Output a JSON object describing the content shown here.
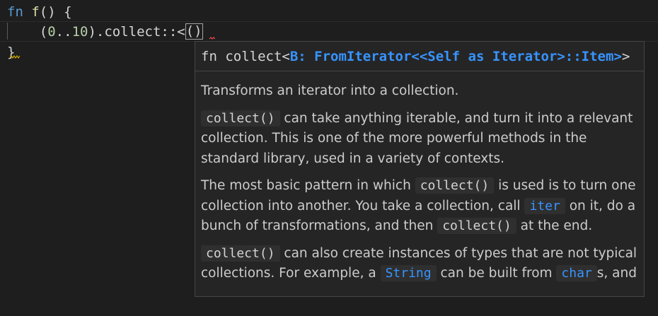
{
  "editor": {
    "line1": {
      "kw": "fn",
      "name": "f",
      "rest": "() {"
    },
    "line2": {
      "indent": "    ",
      "open": "(",
      "start": "0",
      "range": "..",
      "end": "10",
      "close": ").collect::<",
      "cursor_parens": "()"
    },
    "line3": {
      "brace": "}"
    }
  },
  "hover": {
    "signature": {
      "prefix": "fn collect<",
      "bound": "B: FromIterator<<Self as Iterator>::Item>",
      "suffix": ">"
    },
    "paragraphs": {
      "p1": "Transforms an iterator into a collection.",
      "p2_code": "collect()",
      "p2_text": " can take anything iterable, and turn it into a relevant collection. This is one of the more powerful methods in the standard library, used in a variety of contexts.",
      "p3_a": "The most basic pattern in which ",
      "p3_code1": "collect()",
      "p3_b": " is used is to turn one collection into another. You take a collection, call ",
      "p3_code2": "iter",
      "p3_c": " on it, do a bunch of transformations, and then ",
      "p3_code3": "collect()",
      "p3_d": " at the end.",
      "p4_code1": "collect()",
      "p4_a": " can also create instances of types that are not typical collections. For example, a ",
      "p4_code2": "String",
      "p4_b": " can be built from ",
      "p4_code3": "char",
      "p4_c": "s, and"
    }
  },
  "colors": {
    "background": "#1e1e1e",
    "keyword": "#569cd6",
    "function": "#dcdcaa",
    "number": "#b5cea8",
    "link": "#3794ff",
    "hover_bg": "#252526"
  }
}
